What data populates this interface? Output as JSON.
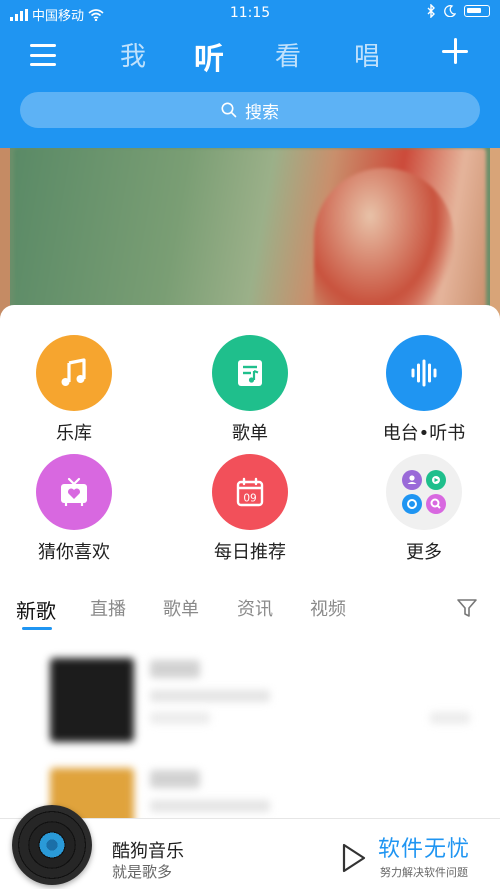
{
  "status_bar": {
    "carrier": "中国移动",
    "time": "11:15"
  },
  "nav": {
    "tabs": [
      "我",
      "听",
      "看",
      "唱"
    ],
    "active_tab": "听"
  },
  "search": {
    "label": "搜索"
  },
  "grid": [
    {
      "label": "乐库",
      "icon": "music-note-icon",
      "color": "#f6a52f"
    },
    {
      "label": "歌单",
      "icon": "playlist-icon",
      "color": "#1fbf8c"
    },
    {
      "label": "电台•听书",
      "icon": "sound-wave-icon",
      "color": "#1f95f2"
    },
    {
      "label": "猜你喜欢",
      "icon": "radio-heart-icon",
      "color": "#d868e0"
    },
    {
      "label": "每日推荐",
      "icon": "calendar-icon",
      "color": "#f2505a",
      "calendar_day": "09"
    },
    {
      "label": "更多",
      "icon": "more-apps-icon",
      "color": "#f0f0f0"
    }
  ],
  "content_tabs": [
    "新歌",
    "直播",
    "歌单",
    "资讯",
    "视频"
  ],
  "player": {
    "title": "酷狗音乐",
    "subtitle": "就是歌多"
  },
  "watermark": {
    "title": "软件无忧",
    "subtitle": "努力解决软件问题"
  },
  "colors": {
    "brand": "#1f95f2"
  }
}
